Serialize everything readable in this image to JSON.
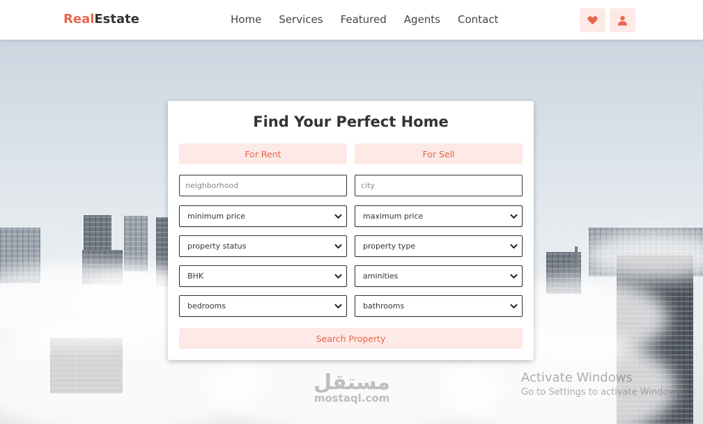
{
  "brand": {
    "part1": "Real",
    "part2": "Estate"
  },
  "nav": {
    "items": [
      "Home",
      "Services",
      "Featured",
      "Agents",
      "Contact"
    ]
  },
  "actions": {
    "heart": "heart-icon",
    "user": "user-icon"
  },
  "colors": {
    "accent": "#e8654d",
    "accent_bg": "#fde9e5"
  },
  "search": {
    "title": "Find Your Perfect Home",
    "tabs": {
      "rent": "For Rent",
      "sell": "For Sell"
    },
    "neighborhood_placeholder": "neighborhood",
    "city_placeholder": "city",
    "selects": {
      "min_price": "minimum price",
      "max_price": "maximum price",
      "status": "property status",
      "type": "property type",
      "bhk": "BHK",
      "amenities": "aminities",
      "bedrooms": "bedrooms",
      "bathrooms": "bathrooms"
    },
    "button": "Search Property"
  },
  "watermark": {
    "arabic": "مستقل",
    "latin": "mostaql.com"
  },
  "activation": {
    "line1": "Activate Windows",
    "line2": "Go to Settings to activate Windows."
  }
}
